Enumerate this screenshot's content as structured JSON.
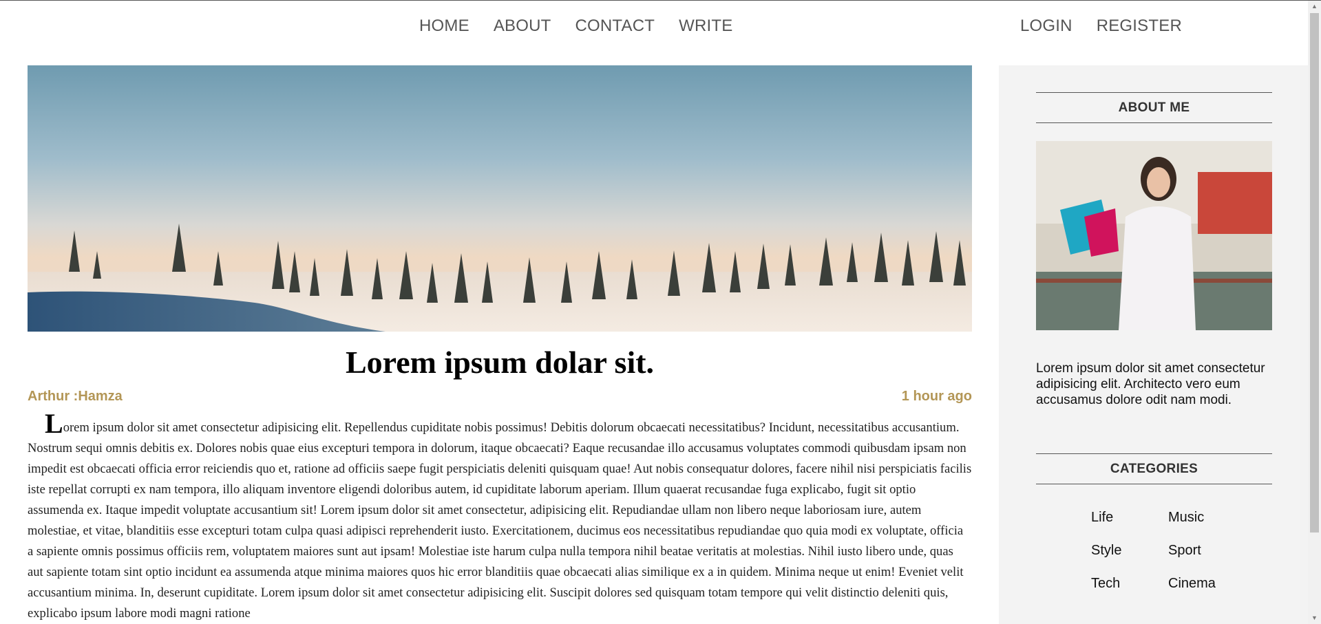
{
  "nav": {
    "center_links": [
      "HOME",
      "ABOUT",
      "CONTACT",
      "WRITE"
    ],
    "right_links": [
      "LOGIN",
      "REGISTER"
    ]
  },
  "post": {
    "title": "Lorem ipsum dolar sit.",
    "author": "Arthur :Hamza",
    "time": "1 hour ago",
    "first_letter": "L",
    "body": "orem ipsum dolor sit amet consectetur adipisicing elit. Repellendus cupiditate nobis possimus! Debitis dolorum obcaecati necessitatibus? Incidunt, necessitatibus accusantium. Nostrum sequi omnis debitis ex. Dolores nobis quae eius excepturi tempora in dolorum, itaque obcaecati? Eaque recusandae illo accusamus voluptates commodi quibusdam ipsam non impedit est obcaecati officia error reiciendis quo et, ratione ad officiis saepe fugit perspiciatis deleniti quisquam quae! Aut nobis consequatur dolores, facere nihil nisi perspiciatis facilis iste repellat corrupti ex nam tempora, illo aliquam inventore eligendi doloribus autem, id cupiditate laborum aperiam. Illum quaerat recusandae fuga explicabo, fugit sit optio assumenda ex. Itaque impedit voluptate accusantium sit! Lorem ipsum dolor sit amet consectetur, adipisicing elit. Repudiandae ullam non libero neque laboriosam iure, autem molestiae, et vitae, blanditiis esse excepturi totam culpa quasi adipisci reprehenderit iusto. Exercitationem, ducimus eos necessitatibus repudiandae quo quia modi ex voluptate, officia a sapiente omnis possimus officiis rem, voluptatem maiores sunt aut ipsam! Molestiae iste harum culpa nulla tempora nihil beatae veritatis at molestias. Nihil iusto libero unde, quas aut sapiente totam sint optio incidunt ea assumenda atque minima maiores quos hic error blanditiis quae obcaecati alias similique ex a in quidem. Minima neque ut enim! Eveniet velit accusantium minima. In, deserunt cupiditate. Lorem ipsum dolor sit amet consectetur adipisicing elit. Suscipit dolores sed quisquam totam tempore qui velit distinctio deleniti quis, explicabo ipsum labore modi magni ratione"
  },
  "sidebar": {
    "about_title": "ABOUT ME",
    "about_text": "Lorem ipsum dolor sit amet consectetur adipisicing elit. Architecto vero eum accusamus dolore odit nam modi.",
    "categories_title": "CATEGORIES",
    "categories": [
      "Life",
      "Music",
      "Style",
      "Sport",
      "Tech",
      "Cinema"
    ]
  },
  "colors": {
    "accent": "#b39656",
    "sidebar_bg": "#f3f3f3",
    "nav_text": "#555555"
  }
}
